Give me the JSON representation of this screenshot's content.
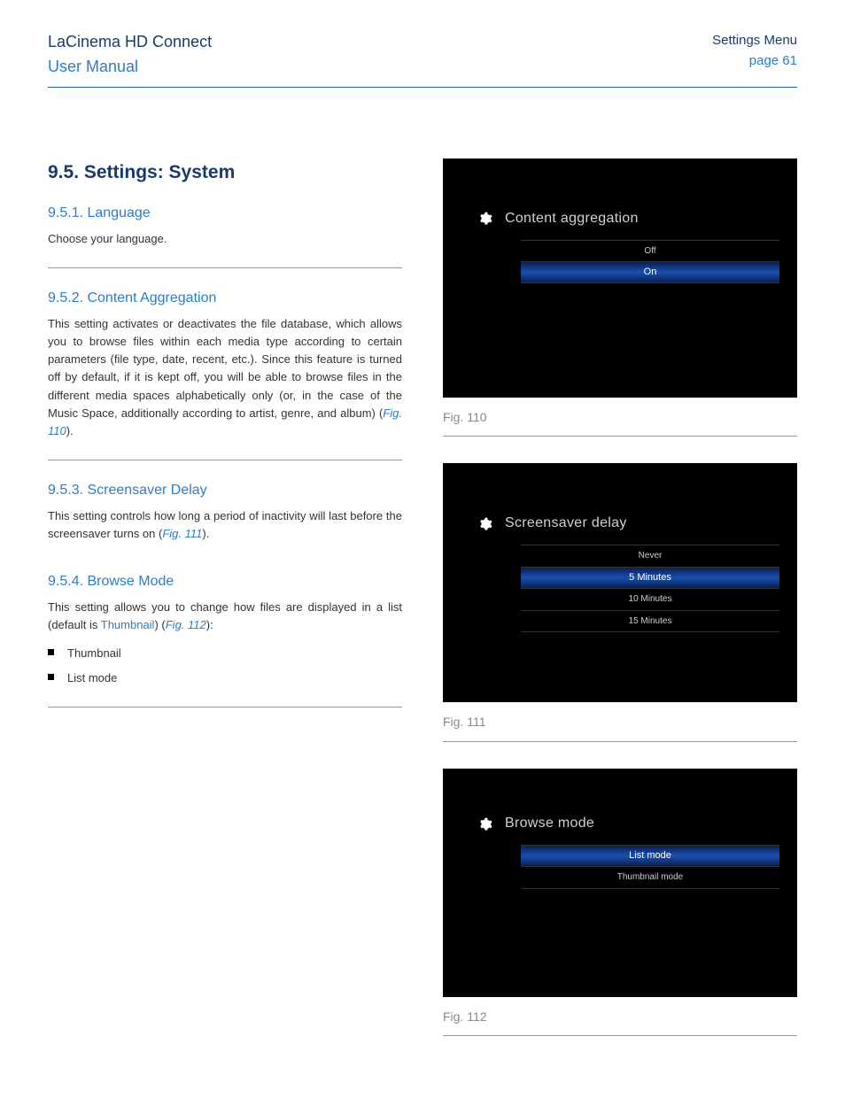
{
  "header": {
    "product": "LaCinema HD Connect",
    "doc_type": "User Manual",
    "section": "Settings Menu",
    "page": "page 61"
  },
  "main_heading": "9.5.  Settings: System",
  "sections": {
    "s1": {
      "heading": "9.5.1.   Language",
      "body": "Choose your language."
    },
    "s2": {
      "heading": "9.5.2.   Content Aggregation",
      "body_a": "This setting activates or deactivates the file database, which allows you to browse files within each media type according to certain parameters (file type, date, recent, etc.).  Since this feature is turned off by default, if it is kept off, you will be able to browse files in the different media spaces alphabetically only (or, in the case of the Music Space, additionally according to artist, genre, and album) (",
      "body_link": "Fig. 110",
      "body_b": ")."
    },
    "s3": {
      "heading": "9.5.3.   Screensaver Delay",
      "body_a": "This setting controls how long a period of inactivity will last before the screensaver turns on (",
      "body_link": "Fig. 111",
      "body_b": ")."
    },
    "s4": {
      "heading": "9.5.4.   Browse Mode",
      "body_a": "This setting allows you to change how files are displayed in a list (default is ",
      "body_link1": "Thumbnail",
      "body_mid": ") (",
      "body_link2": "Fig. 112",
      "body_b": "):",
      "bullets": {
        "b1": "Thumbnail",
        "b2": "List mode"
      }
    }
  },
  "figures": {
    "f110": {
      "title": "Content aggregation",
      "opts": {
        "o1": "Off",
        "o2": "On"
      },
      "selected_index": 1,
      "caption": "Fig. 110"
    },
    "f111": {
      "title": "Screensaver delay",
      "opts": {
        "o1": "Never",
        "o2": "5 Minutes",
        "o3": "10 Minutes",
        "o4": "15 Minutes"
      },
      "selected_index": 1,
      "caption": "Fig. 111"
    },
    "f112": {
      "title": "Browse mode",
      "opts": {
        "o1": "List mode",
        "o2": "Thumbnail mode"
      },
      "selected_index": 0,
      "caption": "Fig. 112"
    }
  }
}
